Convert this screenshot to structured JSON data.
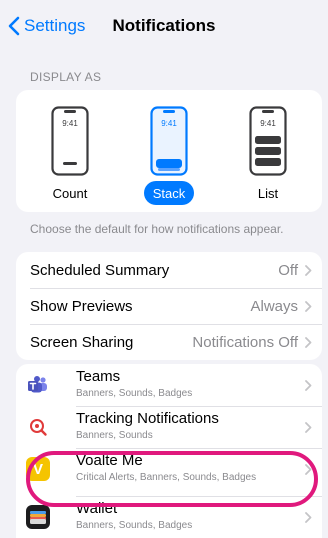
{
  "nav": {
    "back_label": "Settings",
    "title": "Notifications"
  },
  "display_as": {
    "header": "DISPLAY AS",
    "phone_time": "9:41",
    "options": [
      {
        "label": "Count",
        "selected": false
      },
      {
        "label": "Stack",
        "selected": true
      },
      {
        "label": "List",
        "selected": false
      }
    ],
    "footer": "Choose the default for how notifications appear."
  },
  "settings": [
    {
      "label": "Scheduled Summary",
      "value": "Off"
    },
    {
      "label": "Show Previews",
      "value": "Always"
    },
    {
      "label": "Screen Sharing",
      "value": "Notifications Off"
    }
  ],
  "apps": [
    {
      "name": "Teams",
      "subtitle": "Banners, Sounds, Badges",
      "icon": "teams-icon"
    },
    {
      "name": "Tracking Notifications",
      "subtitle": "Banners, Sounds",
      "icon": "tracking-icon"
    },
    {
      "name": "Voalte Me",
      "subtitle": "Critical Alerts, Banners, Sounds, Badges",
      "icon": "voalte-icon",
      "icon_letter": "V",
      "highlighted": true
    },
    {
      "name": "Wallet",
      "subtitle": "Banners, Sounds, Badges",
      "icon": "wallet-icon"
    }
  ],
  "colors": {
    "accent": "#007aff",
    "highlight": "#e0197d",
    "voalte_yellow": "#f5c400"
  }
}
